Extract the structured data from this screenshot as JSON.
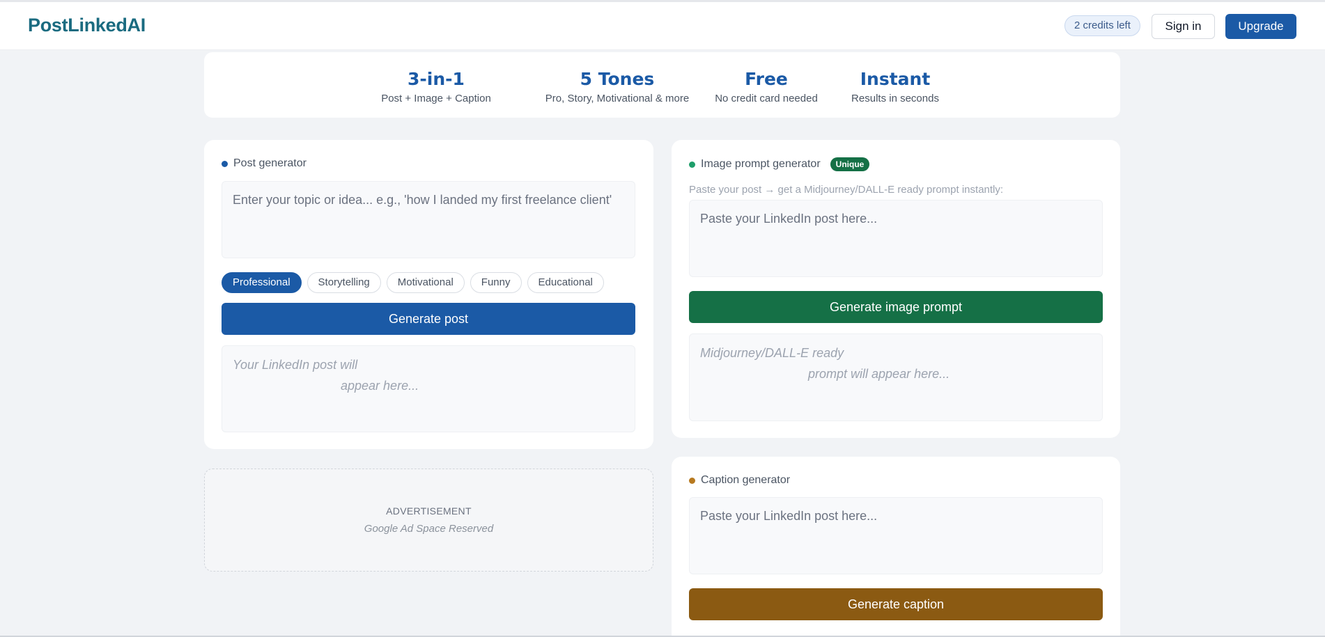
{
  "header": {
    "logo": "PostLinkedAI",
    "credits": "2 credits left",
    "signin": "Sign in",
    "upgrade": "Upgrade"
  },
  "stats": [
    {
      "big": "3-in-1",
      "small": "Post + Image + Caption"
    },
    {
      "big": "5 Tones",
      "small": "Pro, Story, Motivational & more"
    },
    {
      "big": "Free",
      "small": "No credit card needed"
    },
    {
      "big": "Instant",
      "small": "Results in seconds"
    }
  ],
  "post": {
    "title": "Post generator",
    "placeholder": "Enter your topic or idea... e.g., 'how I landed my first freelance client'",
    "tones": [
      "Professional",
      "Storytelling",
      "Motivational",
      "Funny",
      "Educational"
    ],
    "selected_tone": "Professional",
    "button": "Generate post",
    "result_line1": "Your LinkedIn post will",
    "result_line2": "appear here..."
  },
  "image": {
    "title": "Image prompt generator",
    "badge": "Unique",
    "hint": "Paste your post → get a Midjourney/DALL-E ready prompt instantly:",
    "placeholder": "Paste your LinkedIn post here...",
    "button": "Generate image prompt",
    "result_line1": "Midjourney/DALL-E ready",
    "result_line2": "prompt will appear here..."
  },
  "caption": {
    "title": "Caption generator",
    "placeholder": "Paste your LinkedIn post here...",
    "button": "Generate caption"
  },
  "ad": {
    "label": "ADVERTISEMENT",
    "sub": "Google Ad Space Reserved"
  },
  "colors": {
    "brand_blue": "#1b5aa6",
    "image_green": "#157046",
    "caption_brown": "#8b5a12",
    "post_dot": "#1b5aa6",
    "image_dot": "#1e9e6a",
    "caption_dot": "#b7791f"
  }
}
